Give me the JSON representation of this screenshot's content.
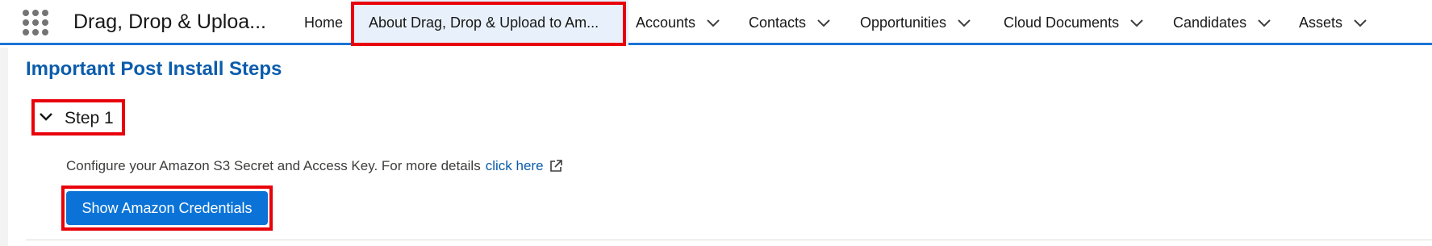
{
  "app": {
    "name": "Drag, Drop & Uploa..."
  },
  "nav": {
    "home": "Home",
    "active": "About Drag, Drop & Upload to Am...",
    "items": [
      {
        "label": "Accounts"
      },
      {
        "label": "Contacts"
      },
      {
        "label": "Opportunities"
      },
      {
        "label": "Cloud Documents"
      },
      {
        "label": "Candidates"
      },
      {
        "label": "Assets"
      }
    ]
  },
  "page": {
    "title": "Important Post Install Steps",
    "step": {
      "label": "Step 1",
      "description": "Configure your Amazon S3 Secret and Access Key. For more details",
      "link": "click here",
      "button": "Show Amazon Credentials"
    }
  },
  "colors": {
    "brand_blue": "#0b5cab",
    "button_blue": "#0b73d8",
    "highlight_red": "#e8000b",
    "active_tab_bg": "#e8f1fb"
  },
  "icons": {
    "launcher": "app-launcher-icon",
    "chevron": "chevron-down-icon",
    "external": "external-link-icon"
  }
}
